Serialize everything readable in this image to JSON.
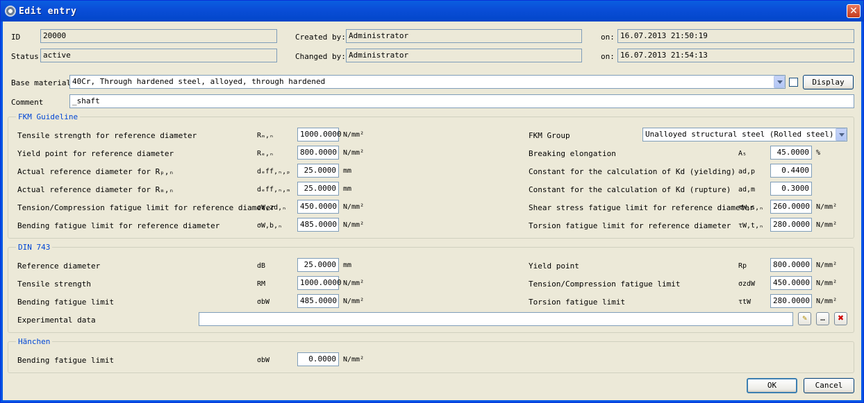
{
  "window": {
    "title": "Edit entry"
  },
  "header": {
    "id_label": "ID",
    "id_value": "20000",
    "status_label": "Status",
    "status_value": "active",
    "created_by_label": "Created by:",
    "created_by_value": "Administrator",
    "changed_by_label": "Changed by:",
    "changed_by_value": "Administrator",
    "on_label": "on:",
    "created_on": "16.07.2013  21:50:19",
    "changed_on": "16.07.2013  21:54:13"
  },
  "base_material": {
    "label": "Base material",
    "value": "40Cr, Through hardened steel, alloyed, through hardened",
    "display_label": "Display"
  },
  "comment": {
    "label": "Comment",
    "value": "_shaft"
  },
  "fkm": {
    "title": "FKM Guideline",
    "left": [
      {
        "label": "Tensile strength for reference diameter",
        "sym": "Rₘ,ₙ",
        "value": "1000.0000",
        "unit": "N/mm²"
      },
      {
        "label": "Yield point for reference diameter",
        "sym": "Rₑ,ₙ",
        "value": "800.0000",
        "unit": "N/mm²"
      },
      {
        "label": "Actual reference diameter for Rₚ,ₙ",
        "sym": "dₑff,ₙ,ₚ",
        "value": "25.0000",
        "unit": "mm"
      },
      {
        "label": "Actual reference diameter for Rₘ,ₙ",
        "sym": "dₑff,ₙ,ₘ",
        "value": "25.0000",
        "unit": "mm"
      },
      {
        "label": "Tension/Compression fatigue limit for reference diameter",
        "sym": "σW,zd,ₙ",
        "value": "450.0000",
        "unit": "N/mm²"
      },
      {
        "label": "Bending fatigue limit for reference diameter",
        "sym": "σW,b,ₙ",
        "value": "485.0000",
        "unit": "N/mm²"
      }
    ],
    "group_label": "FKM Group",
    "group_value": "Unalloyed structural steel (Rolled steel)",
    "right": [
      {
        "label": "Breaking elongation",
        "sym": "A₅",
        "value": "45.0000",
        "unit": "%"
      },
      {
        "label": "Constant for the calculation of Kd (yielding)",
        "sym": "ad,p",
        "value": "0.4400",
        "unit": ""
      },
      {
        "label": "Constant for the calculation of Kd (rupture)",
        "sym": "ad,m",
        "value": "0.3000",
        "unit": ""
      },
      {
        "label": "Shear stress fatigue limit for reference diameter",
        "sym": "τW,s,ₙ",
        "value": "260.0000",
        "unit": "N/mm²"
      },
      {
        "label": "Torsion fatigue limit for reference diameter",
        "sym": "τW,t,ₙ",
        "value": "280.0000",
        "unit": "N/mm²"
      }
    ]
  },
  "din": {
    "title": "DIN 743",
    "left": [
      {
        "label": "Reference diameter",
        "sym": "dB",
        "value": "25.0000",
        "unit": "mm"
      },
      {
        "label": "Tensile strength",
        "sym": "RM",
        "value": "1000.0000",
        "unit": "N/mm²"
      },
      {
        "label": "Bending fatigue limit",
        "sym": "σbW",
        "value": "485.0000",
        "unit": "N/mm²"
      }
    ],
    "right": [
      {
        "label": "Yield point",
        "sym": "Rp",
        "value": "800.0000",
        "unit": "N/mm²"
      },
      {
        "label": "Tension/Compression fatigue limit",
        "sym": "σzdW",
        "value": "450.0000",
        "unit": "N/mm²"
      },
      {
        "label": "Torsion fatigue limit",
        "sym": "τtW",
        "value": "280.0000",
        "unit": "N/mm²"
      }
    ],
    "exp_label": "Experimental data",
    "exp_value": ""
  },
  "haenchen": {
    "title": "Hänchen",
    "row": {
      "label": "Bending fatigue limit",
      "sym": "σbW",
      "value": "0.0000",
      "unit": "N/mm²"
    }
  },
  "buttons": {
    "ok": "OK",
    "cancel": "Cancel"
  }
}
